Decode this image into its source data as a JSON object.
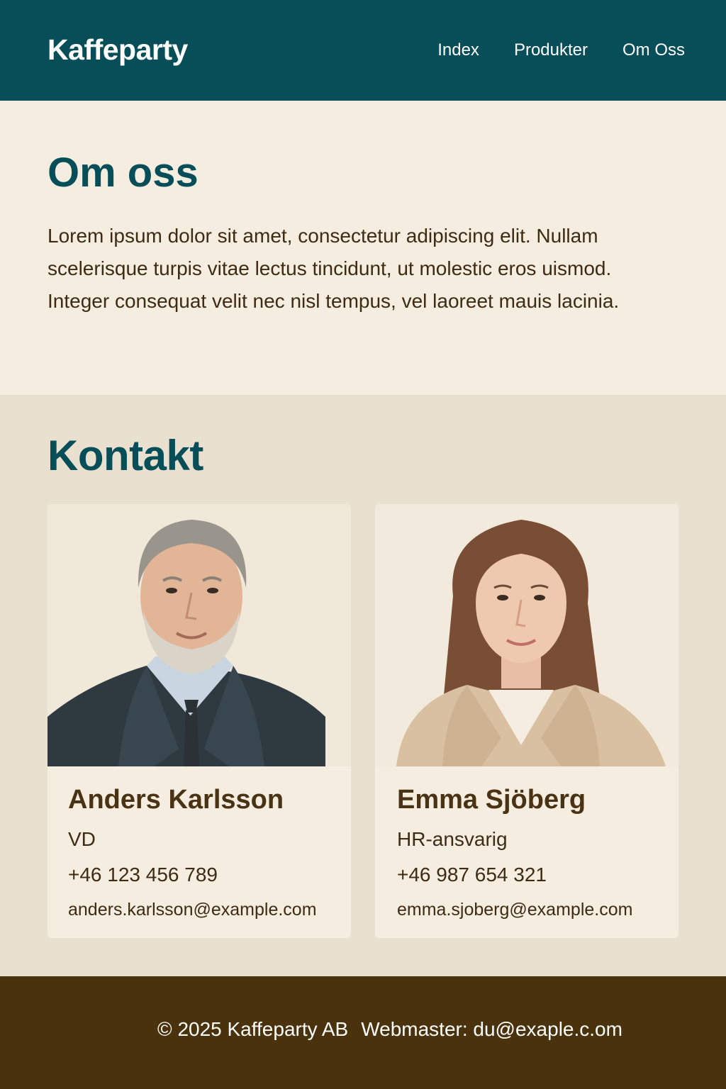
{
  "header": {
    "brand": "Kaffeparty",
    "nav": [
      "Index",
      "Produkter",
      "Om Oss"
    ]
  },
  "about": {
    "title": "Om oss",
    "text": "Lorem ipsum dolor sit amet, consectetur adipiscing elit. Nullam scelerisque turpis vitae lectus tincidunt, ut molestic eros uismod. Integer consequat velit nec nisl tempus, vel laoreet mauis lacinia."
  },
  "contact": {
    "title": "Kontakt",
    "people": [
      {
        "name": "Anders Karlsson",
        "role": "VD",
        "phone": "+46 123 456 789",
        "email": "anders.karlsson@example.com"
      },
      {
        "name": "Emma Sjöberg",
        "role": "HR-ansvarig",
        "phone": "+46 987 654 321",
        "email": "emma.sjoberg@example.com"
      }
    ]
  },
  "footer": {
    "copyright": "© 2025 Kaffeparty AB",
    "webmaster": "Webmaster: du@exaple.c.om"
  },
  "colors": {
    "header_bg": "#074e59",
    "heading": "#074e59",
    "page_bg": "#f5eee0",
    "contact_bg": "#e9e0cf",
    "footer_bg": "#4a320c",
    "text_brown": "#3d2b14"
  }
}
